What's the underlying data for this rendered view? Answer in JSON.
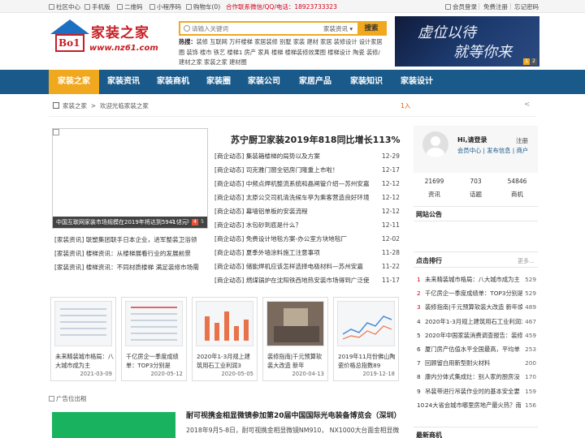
{
  "topbar": {
    "left": [
      {
        "label": "社区中心",
        "icon": "home-icon"
      },
      {
        "label": "手机版",
        "icon": "mobile-icon"
      },
      {
        "label": "二维码",
        "icon": "qrcode-icon"
      },
      {
        "label": "小程序码",
        "icon": "miniprogram-icon"
      },
      {
        "label": "购物车(0)",
        "icon": "cart-icon"
      }
    ],
    "hotline": "合作联系微信/QQ/电话：18923733323",
    "right": [
      "会员登录",
      "免费注册",
      "忘记密码"
    ]
  },
  "logo": {
    "badge": "Bo1",
    "name": "家装之家",
    "url": "www.nz61.com"
  },
  "search": {
    "placeholder": "请输入关键词",
    "scope": "家装资讯",
    "button": "搜索",
    "hot_label": "热搜：",
    "hot_words": "装修 互联网 万杆楼梯 家居装修 别墅 家装 建材 家居 装修设计 设计家居圈 装饰 楼市 铁艺 楼梯1 房产 家具 楼梯 楼梯装修效果图 楼梯设计 陶瓷 装修/ 建材之家 家装之家 建材圈"
  },
  "banner": {
    "line1": "虚位以待",
    "line2": "就等你来",
    "pages": [
      "1",
      "2"
    ]
  },
  "nav": [
    "家装之家",
    "家装资讯",
    "家装商机",
    "家装圈",
    "家装公司",
    "家居产品",
    "家装知识",
    "家装设计"
  ],
  "breadcrumb": {
    "home": "家装之家",
    "sep": ">",
    "current": "欢迎光临家装之家",
    "notice": "1入"
  },
  "slider": {
    "caption": "中国互联网家装市场规模在2019年将达到5941亿元",
    "pages": [
      "1",
      "2",
      "3",
      "4",
      "5"
    ]
  },
  "headline": "苏宁厨卫家装2019年818同比增长113%",
  "news_list": [
    {
      "text": "[商企动态] 集装箱楼梯的局势以及方案",
      "date": "12-29"
    },
    {
      "text": "[商企动态] 司克雅门窗全铝房门隆重上市啦！",
      "date": "12-17"
    },
    {
      "text": "[商企动态] 中频点焊机整流系统和晶闸管介绍—苏州安嘉",
      "date": "12-12"
    },
    {
      "text": "[商企动态] 太原公交司机清洗候车亭为乘客营造良好环境",
      "date": "12-12"
    },
    {
      "text": "[商企动态] 幕墙铝单板的安装流程",
      "date": "12-12"
    },
    {
      "text": "[商企动态] 水包砂到底是什么？",
      "date": "12-11"
    },
    {
      "text": "[商企动态] 免费设计地毯方案-办公室方块地毯厂",
      "date": "12-02"
    },
    {
      "text": "[商企动态] 夏季外墙涂料施工注意事项",
      "date": "11-28"
    },
    {
      "text": "[商企动态] 储能焊机应该怎样选择电极材料—苏州安嘉",
      "date": "11-22"
    },
    {
      "text": "[商企动态] 燃煤锅炉在沈阳铁西地热安装市场得到广泛使",
      "date": "11-17"
    }
  ],
  "left_list": [
    "[家装资讯] 联塑集团联手日本企业，进军整装卫浴领",
    "[家装资讯] 楼梯资讯：从楼梯展看行业的发展前景",
    "[家装资讯] 楼梯资讯：不同材质楼梯 满足装修市场需"
  ],
  "cards": [
    {
      "title": "未来精装城市格局：八大城市成为主",
      "date": "2021-03-09"
    },
    {
      "title": "千亿房企一季度成绩单：TOP3分别是",
      "date": "2020-05-12"
    },
    {
      "title": "2020年1-3月规上建筑用石工业利润3",
      "date": "2020-05-05"
    },
    {
      "title": "装修指南|千元预算软装大改造 新年",
      "date": "2020-04-13"
    },
    {
      "title": "2019年11月份佛山陶瓷价格总指数89",
      "date": "2019-12-18"
    }
  ],
  "ad_label": "广告位出租",
  "news2": {
    "title": "耐可视携金相显微镜参加第20届中国国际光电装备博览会（深圳）",
    "desc": "2018年9月5-8日，耐可视携金相显微镜NM910，  NX1000大台面金相显微"
  },
  "user": {
    "greeting": "Hi,请登录",
    "register": "注册",
    "links": "会员中心 | 发布信息 | 商户"
  },
  "stats": [
    {
      "num": "21699",
      "label": "资讯"
    },
    {
      "num": "703",
      "label": "话题"
    },
    {
      "num": "54846",
      "label": "商机"
    }
  ],
  "sections": {
    "notice": "网站公告",
    "rank": "点击排行",
    "more": "更多...",
    "latest": "最新商机"
  },
  "rank": [
    {
      "no": "1",
      "text": "未来精装城市格局：八大城市成为主",
      "count": "529"
    },
    {
      "no": "2",
      "text": "千亿房企一季度成绩单：TOP3分别是",
      "count": "529"
    },
    {
      "no": "3",
      "text": "装修指南|千元预算软装大改造 新年焕",
      "count": "489"
    },
    {
      "no": "4",
      "text": "2020年1-3月规上建筑用石工业利润3",
      "count": "467"
    },
    {
      "no": "5",
      "text": "2020年中国家装消费调查报告：装修",
      "count": "459"
    },
    {
      "no": "6",
      "text": "厦门房产估值水平全国最高，平均单",
      "count": "253"
    },
    {
      "no": "7",
      "text": "回顾留白用新型耐火材料",
      "count": "200"
    },
    {
      "no": "8",
      "text": "康内分体式集成灶：别人家的厨房没",
      "count": "170"
    },
    {
      "no": "9",
      "text": "吊装带进行吊装作业时的基本安全要",
      "count": "159"
    },
    {
      "no": "10",
      "text": "24大省会城市哪里房地产最火热？南",
      "count": "156"
    }
  ]
}
